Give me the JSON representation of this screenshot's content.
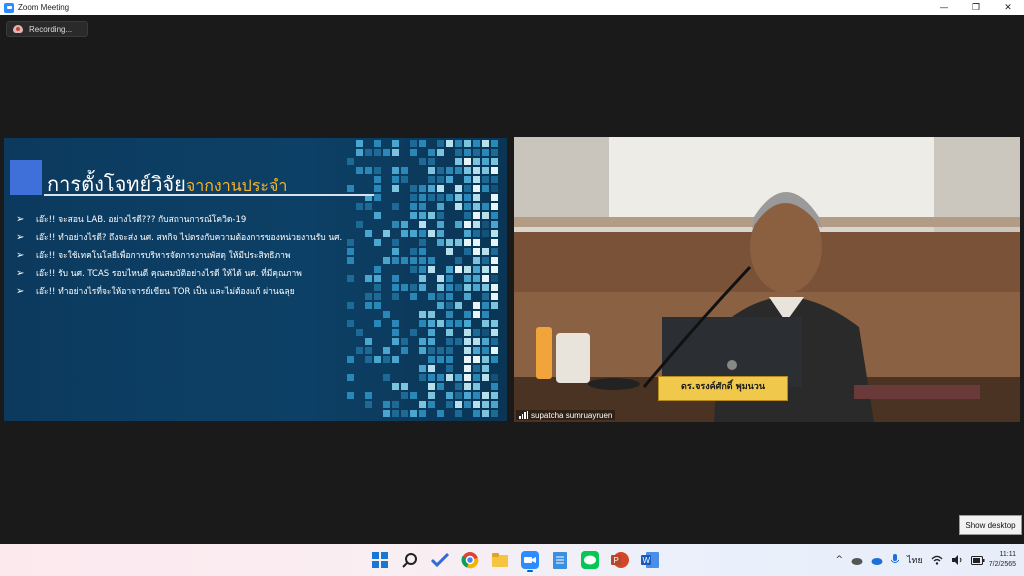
{
  "window": {
    "title": "Zoom Meeting",
    "controls": {
      "minimize": "—",
      "restore": "❐",
      "close": "✕"
    }
  },
  "recording": {
    "label": "Recording..."
  },
  "slide": {
    "title_main": "การตั้งโจทย์วิจัย",
    "title_accent": "จากงานประจำ",
    "bullets": [
      "เอ๊ะ!! จะสอน LAB. อย่างไรดี??? กับสถานการณ์โควิด-19",
      "เอ๊ะ!! ทำอย่างไรดี? ถึงจะส่ง นศ. สหกิจ ไปตรงกับความต้องการของหน่วยงานรับ นศ.",
      "เอ๊ะ!! จะใช้เทคโนโลยีเพื่อการบริหารจัดการงานพัสดุ ให้มีประสิทธิภาพ",
      "เอ๊ะ!! รับ นศ. TCAS รอบไหนดี คุณสมบัติอย่างไรดี ให้ได้ นศ. ที่มีคุณภาพ",
      "เอ๊ะ!! ทำอย่างไรที่จะให้อาจารย์เขียน TOR เป็น และไม่ต้องแก้ ผ่านฉลุย"
    ],
    "bullet_symbol": "➢",
    "colors": {
      "background": "#0c3a5e",
      "accent": "#f7b52a",
      "square": "#3f6fd8"
    }
  },
  "video": {
    "nameplate": "ดร.จรงค์ศักดิ์ พุมนวน",
    "participant_name": "supatcha sumruayruen"
  },
  "tooltip": {
    "label": "Show desktop"
  },
  "taskbar": {
    "apps": [
      {
        "name": "start-icon"
      },
      {
        "name": "search-icon"
      },
      {
        "name": "todo-icon"
      },
      {
        "name": "chrome-icon"
      },
      {
        "name": "file-explorer-icon"
      },
      {
        "name": "zoom-icon"
      },
      {
        "name": "notepad-icon"
      },
      {
        "name": "line-icon"
      },
      {
        "name": "powerpoint-icon"
      },
      {
        "name": "word-icon"
      }
    ],
    "tray": {
      "chevron": "^",
      "language": "ไทย",
      "time": "11:11",
      "date": "7/2/2565"
    }
  }
}
